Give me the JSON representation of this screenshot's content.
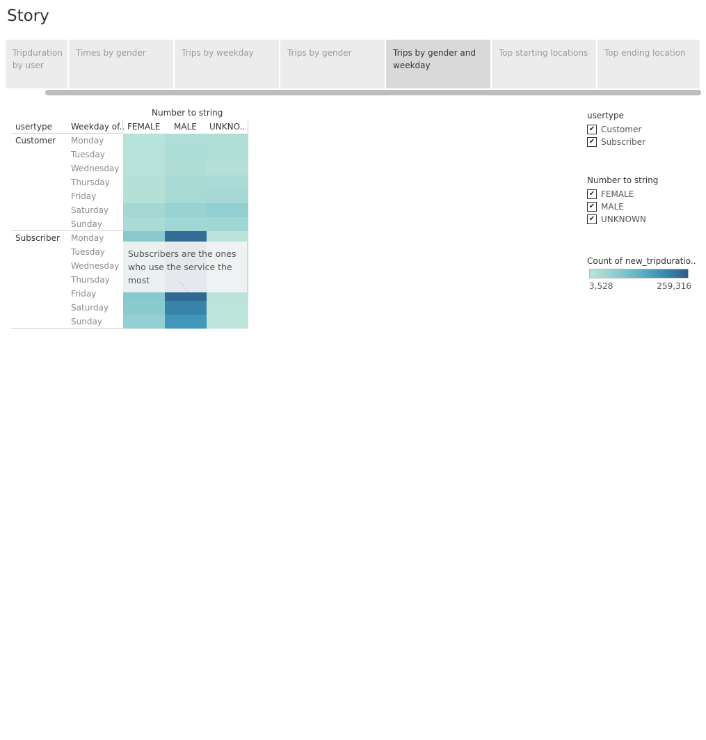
{
  "page": {
    "title": "Story"
  },
  "tabs": [
    {
      "label": "Tripduration by user",
      "active": false
    },
    {
      "label": "Times by gender",
      "active": false
    },
    {
      "label": "Trips by weekday",
      "active": false
    },
    {
      "label": "Trips by gender",
      "active": false
    },
    {
      "label": "Trips by gender and weekday",
      "active": true
    },
    {
      "label": "Top starting locations",
      "active": false
    },
    {
      "label": "Top ending location",
      "active": false
    }
  ],
  "table": {
    "column_group_header": "Number to string",
    "row_headers": [
      "usertype",
      "Weekday of.."
    ],
    "columns": [
      "FEMALE",
      "MALE",
      "UNKNO.."
    ],
    "groups": [
      {
        "name": "Customer",
        "days": [
          "Monday",
          "Tuesday",
          "Wednesday",
          "Thursday",
          "Friday",
          "Saturday",
          "Sunday"
        ]
      },
      {
        "name": "Subscriber",
        "days": [
          "Monday",
          "Tuesday",
          "Wednesday",
          "Thursday",
          "Friday",
          "Saturday",
          "Sunday"
        ]
      }
    ]
  },
  "chart_data": {
    "type": "heatmap",
    "x_categories": [
      "FEMALE",
      "MALE",
      "UNKNOWN"
    ],
    "y_groups": [
      "Customer",
      "Subscriber"
    ],
    "y_categories": [
      "Monday",
      "Tuesday",
      "Wednesday",
      "Thursday",
      "Friday",
      "Saturday",
      "Sunday"
    ],
    "color_range": [
      3528,
      259316
    ],
    "values": {
      "Customer": [
        [
          10000,
          22000,
          20000
        ],
        [
          10000,
          24000,
          18000
        ],
        [
          9000,
          20000,
          15000
        ],
        [
          14000,
          30000,
          28000
        ],
        [
          14000,
          32000,
          34000
        ],
        [
          38000,
          52000,
          62000
        ],
        [
          28000,
          42000,
          42000
        ]
      ],
      "Subscriber": [
        [
          75000,
          235000,
          6000
        ],
        [
          80000,
          250000,
          5000
        ],
        [
          80000,
          255000,
          5000
        ],
        [
          82000,
          259316,
          5000
        ],
        [
          78000,
          240000,
          5000
        ],
        [
          72000,
          200000,
          3528
        ],
        [
          58000,
          170000,
          3600
        ]
      ]
    }
  },
  "annotation": {
    "text": "Subscribers are the ones who use the service the most"
  },
  "legends": {
    "usertype": {
      "title": "usertype",
      "items": [
        "Customer",
        "Subscriber"
      ]
    },
    "gender": {
      "title": "Number to string",
      "items": [
        "FEMALE",
        "MALE",
        "UNKNOWN"
      ]
    },
    "color": {
      "title": "Count of new_tripduratio..",
      "min_label": "3,528",
      "max_label": "259,316",
      "colors": [
        "#bce4da",
        "#7ec5cc",
        "#3d95b8",
        "#2c5d88"
      ]
    }
  }
}
